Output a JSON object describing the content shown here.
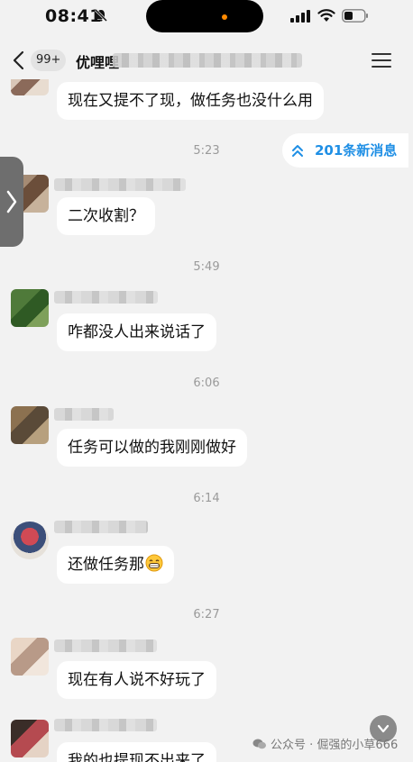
{
  "status_bar": {
    "time": "08:41"
  },
  "nav": {
    "unread_count": "99+",
    "title": "优哩哩"
  },
  "new_messages": {
    "label": "201条新消息"
  },
  "messages": [
    {
      "text": "现在又提不了现，做任务也没什么用"
    },
    {
      "timestamp": "5:23",
      "text": "二次收割？"
    },
    {
      "timestamp": "5:49",
      "text": "咋都没人出来说话了"
    },
    {
      "timestamp": "6:06",
      "text": "任务可以做的我刚刚做好"
    },
    {
      "timestamp": "6:14",
      "text": "还做任务那"
    },
    {
      "timestamp": "6:27",
      "text": "现在有人说不好玩了"
    },
    {
      "text": "我的也提现不出来了"
    }
  ],
  "watermark": {
    "text": "公众号 · 倔强的小草666"
  },
  "colors": {
    "accent": "#1f8fe5",
    "background": "#f2f2f2",
    "bubble": "#ffffff",
    "island_dot": "#ff8a00"
  },
  "icons": [
    "bell-off-icon",
    "signal-icon",
    "wifi-icon",
    "battery-icon",
    "back-icon",
    "menu-icon",
    "double-chevron-up-icon",
    "chevron-right-icon",
    "grin-emoji-icon",
    "chevron-down-icon",
    "wechat-icon"
  ]
}
